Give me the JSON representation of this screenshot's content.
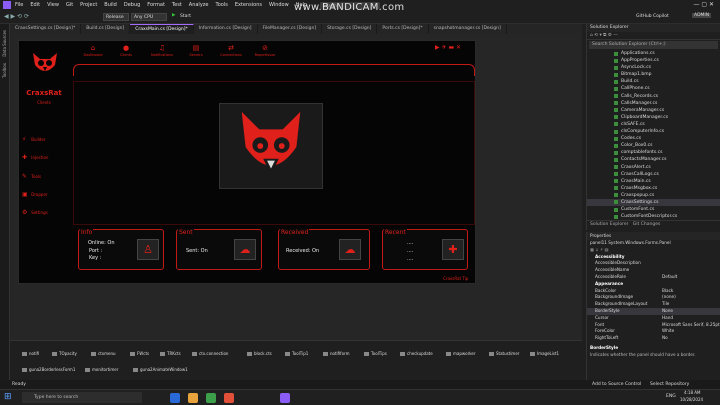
{
  "watermark": "www.BANDICAM.com",
  "menu": [
    "File",
    "Edit",
    "View",
    "Git",
    "Project",
    "Build",
    "Debug",
    "Format",
    "Test",
    "Analyze",
    "Tools",
    "Extensions",
    "Window",
    "Help"
  ],
  "search_placeholder": "Search",
  "toolbar": {
    "config": "Release",
    "platform": "Any CPU",
    "start": "Start",
    "copilot": "GitHub Copilot",
    "user": "ADMIN"
  },
  "tabs": [
    "CraxsSettings.cs [Design]*",
    "Build.cs [Design]",
    "CraxsMain.cs [Design]*",
    "Information.cs [Design]",
    "FileManager.cs [Design]",
    "Storage.cs [Design]",
    "Ports.cs [Design]*",
    "snapshotmanager.cs [Design]"
  ],
  "left_strip": [
    "Data Sources",
    "Toolbox"
  ],
  "nav": [
    "Dashboard",
    "Clients",
    "Notifications",
    "Servers",
    "Connections",
    "ReportIssue"
  ],
  "sidebar": {
    "brand": "CraxsRat",
    "subtitle": "Clients",
    "items": [
      "Builder",
      "Injection",
      "Tools",
      "Dropper",
      "Settings"
    ]
  },
  "panels": {
    "info": {
      "title": "Info",
      "online": "Online:",
      "online_v": "On",
      "port": "Port :",
      "key": "Key :"
    },
    "sent": {
      "title": "Sent",
      "label": "Sent:",
      "value": "On"
    },
    "received": {
      "title": "Received",
      "label": "Received:",
      "value": "On"
    },
    "recent": {
      "title": "Recent",
      "lines": [
        "....",
        "....",
        "...."
      ]
    }
  },
  "tooltip": "CraxsRat Tip",
  "components": [
    "notifi",
    "TOpacity",
    "ctxmenu",
    "FWcts",
    "TRKcts",
    "ctx.connection",
    "block.cts",
    "ToolTip1",
    "notifiform",
    "ToolTips",
    "checkupdate",
    "mapworker",
    "Statustimer",
    "ImageList1",
    "guna2BorderlessForm1",
    "monitortimer",
    "guna2AnimateWindow1"
  ],
  "solution_explorer": {
    "title": "Solution Explorer",
    "search": "Search Solution Explorer (Ctrl+;)",
    "files": [
      "Applications.cs",
      "AppProperties.cs",
      "AsyncLock.cs",
      "Bitmap1.bmp",
      "Build.cs",
      "CallPhone.cs",
      "Calls_Records.cs",
      "CallsManager.cs",
      "CameraManager.cs",
      "ClipboardManager.cs",
      "clsSAFE.cs",
      "clsComputerInfo.cs",
      "Codes.cs",
      "Color_Box0.cs",
      "comptablefonts.cs",
      "ContactsManager.cs",
      "CraxsAlert.cs",
      "CraxsCallLogs.cs",
      "CraxsMain.cs",
      "CraxsMsgbox.cs",
      "Craxspopup.cs",
      "CraxsSettings.cs",
      "CustomFont.cs",
      "CustomFontDescriptor.cs"
    ],
    "bottom_tabs": [
      "Solution Explorer",
      "Git Changes"
    ]
  },
  "properties": {
    "title": "Properties",
    "object": "panel11 System.Windows.Forms.Panel",
    "rows": [
      {
        "c": true,
        "k": "Accessibility",
        "v": ""
      },
      {
        "k": "AccessibleDescription",
        "v": ""
      },
      {
        "k": "AccessibleName",
        "v": ""
      },
      {
        "k": "AccessibleRole",
        "v": "Default"
      },
      {
        "c": true,
        "k": "Appearance",
        "v": ""
      },
      {
        "k": "BackColor",
        "v": "Black"
      },
      {
        "k": "BackgroundImage",
        "v": "(none)"
      },
      {
        "k": "BackgroundImageLayout",
        "v": "Tile"
      },
      {
        "k": "BorderStyle",
        "v": "None"
      },
      {
        "k": "Cursor",
        "v": "Hand"
      },
      {
        "k": "Font",
        "v": "Microsoft Sans Serif, 8.25pt"
      },
      {
        "k": "ForeColor",
        "v": "White"
      },
      {
        "k": "RightToLeft",
        "v": "No"
      }
    ],
    "desc_title": "BorderStyle",
    "desc": "Indicates whether the panel should have a border."
  },
  "status": {
    "ready": "Ready",
    "source": "Add to Source Control",
    "repo": "Select Repository"
  },
  "taskbar": {
    "search": "Type here to search",
    "lang": "ENG",
    "time": "4:18 AM",
    "date": "10/28/2024"
  }
}
